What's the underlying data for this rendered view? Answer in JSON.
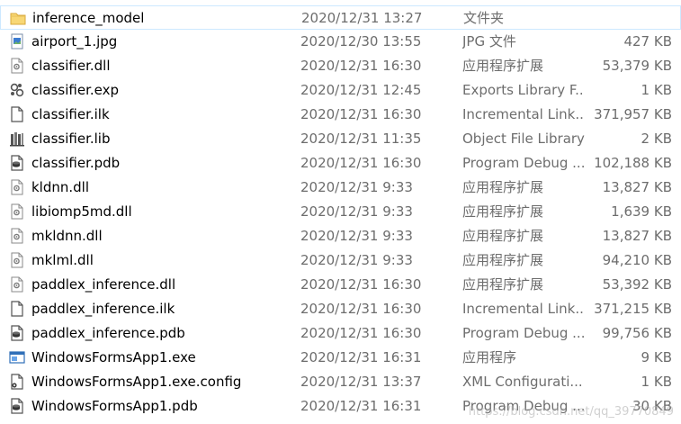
{
  "files": [
    {
      "name": "inference_model",
      "date": "2020/12/31 13:27",
      "type": "文件夹",
      "size": "",
      "icon": "folder-icon",
      "selected": true
    },
    {
      "name": "airport_1.jpg",
      "date": "2020/12/30 13:55",
      "type": "JPG 文件",
      "size": "427 KB",
      "icon": "image-file-icon"
    },
    {
      "name": "classifier.dll",
      "date": "2020/12/31 16:30",
      "type": "应用程序扩展",
      "size": "53,379 KB",
      "icon": "dll-file-icon"
    },
    {
      "name": "classifier.exp",
      "date": "2020/12/31 12:45",
      "type": "Exports Library F...",
      "size": "1 KB",
      "icon": "exp-file-icon"
    },
    {
      "name": "classifier.ilk",
      "date": "2020/12/31 16:30",
      "type": "Incremental Link...",
      "size": "371,957 KB",
      "icon": "ilk-file-icon"
    },
    {
      "name": "classifier.lib",
      "date": "2020/12/31 11:35",
      "type": "Object File Library",
      "size": "2 KB",
      "icon": "lib-file-icon"
    },
    {
      "name": "classifier.pdb",
      "date": "2020/12/31 16:30",
      "type": "Program Debug ...",
      "size": "102,188 KB",
      "icon": "pdb-file-icon"
    },
    {
      "name": "kldnn.dll",
      "date": "2020/12/31 9:33",
      "type": "应用程序扩展",
      "size": "13,827 KB",
      "icon": "dll-file-icon"
    },
    {
      "name": "libiomp5md.dll",
      "date": "2020/12/31 9:33",
      "type": "应用程序扩展",
      "size": "1,639 KB",
      "icon": "dll-file-icon"
    },
    {
      "name": "mkldnn.dll",
      "date": "2020/12/31 9:33",
      "type": "应用程序扩展",
      "size": "13,827 KB",
      "icon": "dll-file-icon"
    },
    {
      "name": "mklml.dll",
      "date": "2020/12/31 9:33",
      "type": "应用程序扩展",
      "size": "94,210 KB",
      "icon": "dll-file-icon"
    },
    {
      "name": "paddlex_inference.dll",
      "date": "2020/12/31 16:30",
      "type": "应用程序扩展",
      "size": "53,392 KB",
      "icon": "dll-file-icon"
    },
    {
      "name": "paddlex_inference.ilk",
      "date": "2020/12/31 16:30",
      "type": "Incremental Link...",
      "size": "371,215 KB",
      "icon": "ilk-file-icon"
    },
    {
      "name": "paddlex_inference.pdb",
      "date": "2020/12/31 16:30",
      "type": "Program Debug ...",
      "size": "99,756 KB",
      "icon": "pdb-file-icon"
    },
    {
      "name": "WindowsFormsApp1.exe",
      "date": "2020/12/31 16:31",
      "type": "应用程序",
      "size": "9 KB",
      "icon": "exe-file-icon"
    },
    {
      "name": "WindowsFormsApp1.exe.config",
      "date": "2020/12/31 13:37",
      "type": "XML Configurati...",
      "size": "1 KB",
      "icon": "config-file-icon"
    },
    {
      "name": "WindowsFormsApp1.pdb",
      "date": "2020/12/31 16:31",
      "type": "Program Debug ...",
      "size": "30 KB",
      "icon": "pdb-file-icon"
    }
  ],
  "watermark": "https://blog.csdn.net/qq_39770849"
}
